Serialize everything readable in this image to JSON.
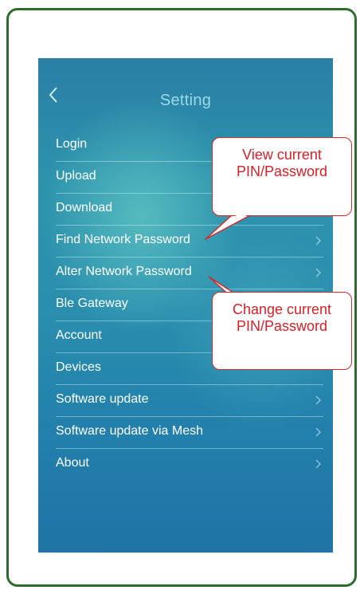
{
  "screen": {
    "title": "Setting",
    "back_icon": "chevron-left-icon"
  },
  "menu": {
    "items": [
      {
        "label": "Login",
        "chevron": false
      },
      {
        "label": "Upload",
        "chevron": false
      },
      {
        "label": "Download",
        "chevron": false
      },
      {
        "label": "Find Network Password",
        "chevron": true
      },
      {
        "label": "Alter Network Password",
        "chevron": true
      },
      {
        "label": "Ble Gateway",
        "chevron": false
      },
      {
        "label": "Account",
        "chevron": false
      },
      {
        "label": "Devices",
        "chevron": false
      },
      {
        "label": "Software update",
        "chevron": true
      },
      {
        "label": "Software update via Mesh",
        "chevron": true
      },
      {
        "label": "About",
        "chevron": true
      }
    ]
  },
  "callouts": {
    "view_pin": {
      "line1": "View current",
      "line2": "PIN/Password"
    },
    "change_pin": {
      "line1": "Change current",
      "line2": "PIN/Password"
    }
  },
  "colors": {
    "frame_border": "#2e6b2c",
    "callout_text": "#d81f26",
    "title_text": "#9bd9ea"
  }
}
